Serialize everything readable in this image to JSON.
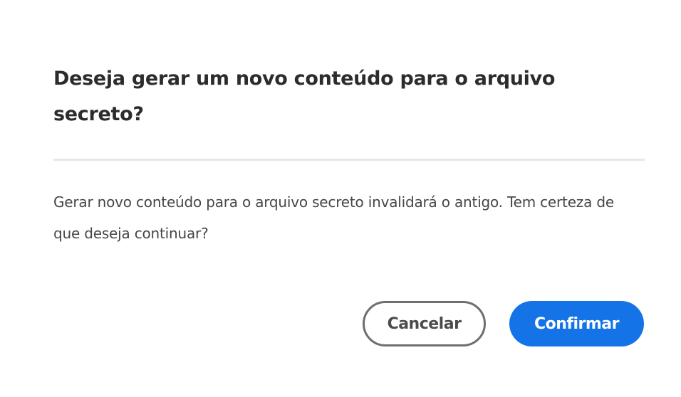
{
  "dialog": {
    "title": "Deseja gerar um novo conteúdo para o arquivo secreto?",
    "message": "Gerar novo conteúdo para o arquivo secreto invalidará o antigo. Tem certeza de que deseja continuar?",
    "cancel_label": "Cancelar",
    "confirm_label": "Confirmar",
    "accent_color": "#1473e6"
  }
}
